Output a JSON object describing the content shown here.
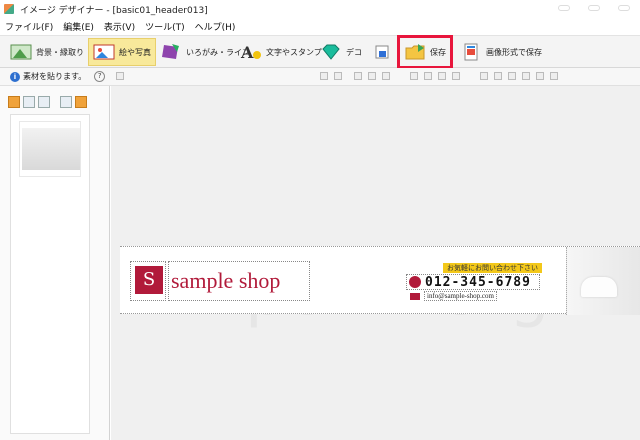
{
  "window": {
    "title": "イメージ デザイナー - [basic01_header013]"
  },
  "menu": [
    "ファイル(F)",
    "編集(E)",
    "表示(V)",
    "ツール(T)",
    "ヘルプ(H)"
  ],
  "toolbar": {
    "items": [
      {
        "label": "背景・縁取り",
        "icon": "landscape-icon"
      },
      {
        "label": "絵や写真",
        "icon": "picture-icon"
      },
      {
        "label": "いろがみ・ライン",
        "icon": "paper-icon"
      },
      {
        "label": "文字やスタンプ",
        "icon": "text-icon"
      },
      {
        "label": "デコ",
        "icon": "gem-icon"
      },
      {
        "label": "",
        "icon": "frame-icon"
      },
      {
        "label": "保存",
        "icon": "folder-save-icon"
      },
      {
        "label": "画像形式で保存",
        "icon": "export-icon"
      }
    ]
  },
  "sidebar": {
    "hint": "素材を貼ります。",
    "help": "?"
  },
  "watermark": "k-point.org",
  "banner": {
    "logo_letter": "S",
    "shop_name": "sample shop",
    "contact_label": "お気軽にお問い合わせ下さい",
    "phone": "012-345-6789",
    "email": "info@sample-shop.com"
  },
  "colors": {
    "accent": "#b11a3a",
    "highlight": "#e8163c",
    "active_tab": "#f8e99b"
  }
}
